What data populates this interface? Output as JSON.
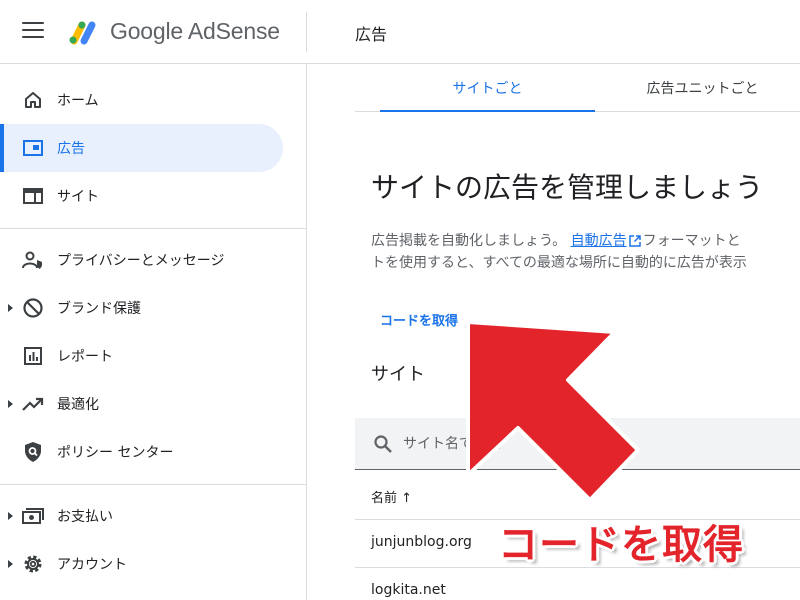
{
  "app": {
    "brand": "Google AdSense",
    "page_title": "広告"
  },
  "colors": {
    "accent": "#1a73e8",
    "annotation": "#e3242b",
    "active_bg": "#e8f0fe"
  },
  "sidebar": {
    "items": [
      {
        "label": "ホーム",
        "icon": "home-icon"
      },
      {
        "label": "広告",
        "icon": "ads-icon"
      },
      {
        "label": "サイト",
        "icon": "sites-icon"
      },
      {
        "label": "プライバシーとメッセージ",
        "icon": "privacy-icon"
      },
      {
        "label": "ブランド保護",
        "icon": "block-icon"
      },
      {
        "label": "レポート",
        "icon": "reports-icon"
      },
      {
        "label": "最適化",
        "icon": "trending-icon"
      },
      {
        "label": "ポリシー センター",
        "icon": "policy-icon"
      },
      {
        "label": "お支払い",
        "icon": "payments-icon"
      },
      {
        "label": "アカウント",
        "icon": "gear-icon"
      }
    ]
  },
  "tabs": [
    {
      "label": "サイトごと"
    },
    {
      "label": "広告ユニットごと"
    }
  ],
  "main": {
    "heading": "サイトの広告を管理しましょう",
    "desc_line1_pre": "広告掲載を自動化しましょう。",
    "desc_link": "自動広告",
    "desc_line1_post": "フォーマットと",
    "desc_line2": "トを使用すると、すべての最適な場所に自動的に広告が表示",
    "get_code_label": "コードを取得",
    "section_title": "サイト",
    "search_placeholder": "サイト名で検索",
    "column_name": "名前 ↑",
    "rows": [
      {
        "name": "junjunblog.org"
      },
      {
        "name": "logkita.net"
      }
    ]
  },
  "annotation": {
    "text": "コードを取得"
  }
}
